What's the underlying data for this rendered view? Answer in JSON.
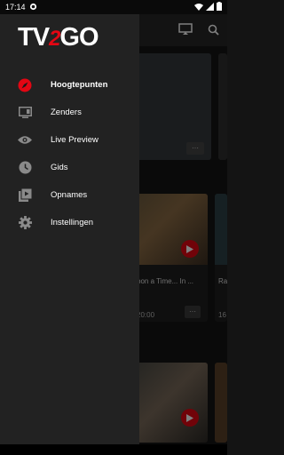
{
  "status_bar": {
    "time": "17:14"
  },
  "brand": {
    "logo_left": "TV",
    "logo_mid": "2",
    "logo_right": "GO",
    "accent": "#e30613"
  },
  "menu": {
    "items": [
      {
        "label": "Hoogtepunten",
        "icon": "compass-icon",
        "active": true
      },
      {
        "label": "Zenders",
        "icon": "tv-screen-icon",
        "active": false
      },
      {
        "label": "Live Preview",
        "icon": "eye-icon",
        "active": false
      },
      {
        "label": "Gids",
        "icon": "clock-icon",
        "active": false
      },
      {
        "label": "Opnames",
        "icon": "recordings-icon",
        "active": false
      },
      {
        "label": "Instellingen",
        "icon": "gear-icon",
        "active": false
      }
    ]
  },
  "background": {
    "card_title": "pon a Time... In ...",
    "card_time": "20:00",
    "card_title_right": "Ra",
    "card_time_right": "16",
    "more_label": "···"
  }
}
